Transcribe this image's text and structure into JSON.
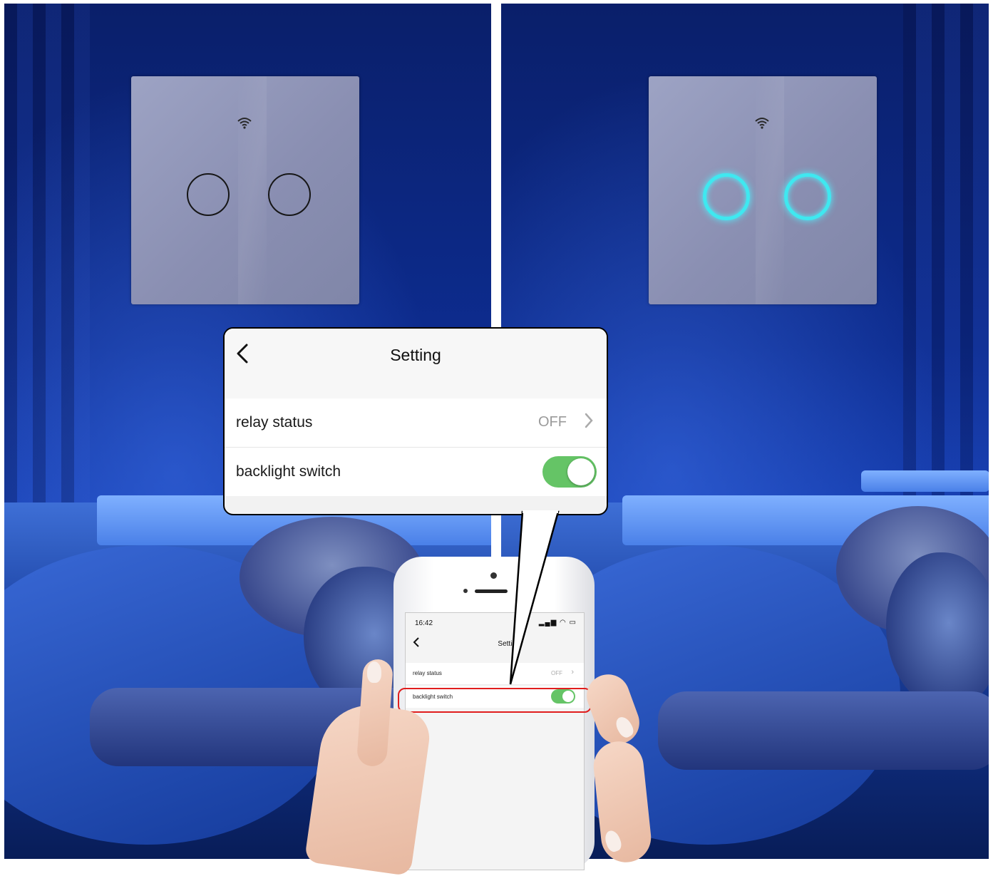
{
  "settings_screen": {
    "title": "Setting",
    "rows": [
      {
        "label": "relay status",
        "value": "OFF"
      },
      {
        "label": "backlight switch",
        "toggle_on": true
      }
    ],
    "toggle_color": "#65c466"
  },
  "phone": {
    "status_time": "16:42",
    "status_icons": "▂▄▆ ◠ ▭"
  },
  "icons": {
    "back": "back-chevron-icon",
    "chevron": "chevron-right-icon",
    "wifi": "wifi-icon"
  },
  "colors": {
    "backlight_on": "#3fe8f0",
    "highlight": "#e01d1d"
  }
}
